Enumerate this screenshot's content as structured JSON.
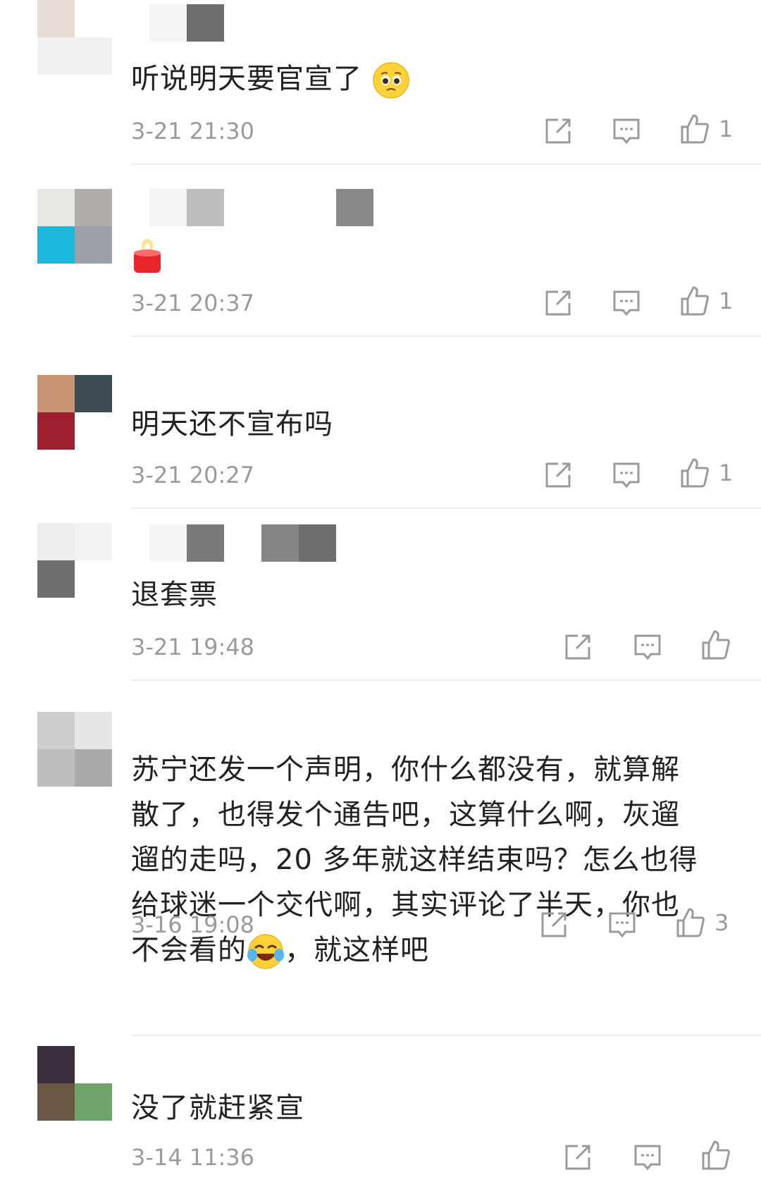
{
  "colors": {
    "text": "#222222",
    "meta": "#9a9a9a",
    "divider": "#ececec"
  },
  "comments": [
    {
      "text": "听说明天要官宣了",
      "emoji": "pleading-face-emoji",
      "time": "3-21 21:30",
      "likes": "1",
      "avatar_colors": [
        "#e8dcd6",
        "#ffffff",
        "#f1f1f1",
        "#f1f1f1"
      ]
    },
    {
      "text": "",
      "emoji": "red-candle-emoji",
      "time": "3-21 20:37",
      "likes": "1",
      "avatar_colors": [
        "#e6e8e3",
        "#b3adaa",
        "#1bb8dc",
        "#9aa0a6"
      ]
    },
    {
      "text": "明天还不宣布吗",
      "time": "3-21 20:27",
      "likes": "1",
      "avatar_colors": [
        "#c99473",
        "#3d4c52",
        "#9e1f2e",
        "#ffffff"
      ]
    },
    {
      "text": "退套票",
      "time": "3-21 19:48",
      "likes": "",
      "avatar_colors": [
        "#eeeeee",
        "#f2f2f2",
        "#6f6f6f",
        "#ffffff"
      ]
    },
    {
      "text_lines": [
        "苏宁还发一个声明，你什么都没有，就算解",
        "散了，也得发个通告吧，这算什么啊，灰遛",
        "遛的走吗，20 多年就这样结束吗？怎么也得",
        "给球迷一个交代啊，其实评论了半天，你也"
      ],
      "text_last_before": "不会看的",
      "text_last_after": "，就这样吧",
      "emoji": "laughing-tears-emoji",
      "time": "3-16 19:08",
      "likes": "3",
      "avatar_colors": [
        "#cdcdcd",
        "#e6e6e6",
        "#bdbdbd",
        "#a9a9a9"
      ]
    },
    {
      "text": "没了就赶紧宣",
      "time": "3-14 11:36",
      "likes": "",
      "avatar_colors": [
        "#3a2d3d",
        "#ffffff",
        "#6b5844",
        "#70a36a"
      ]
    }
  ]
}
